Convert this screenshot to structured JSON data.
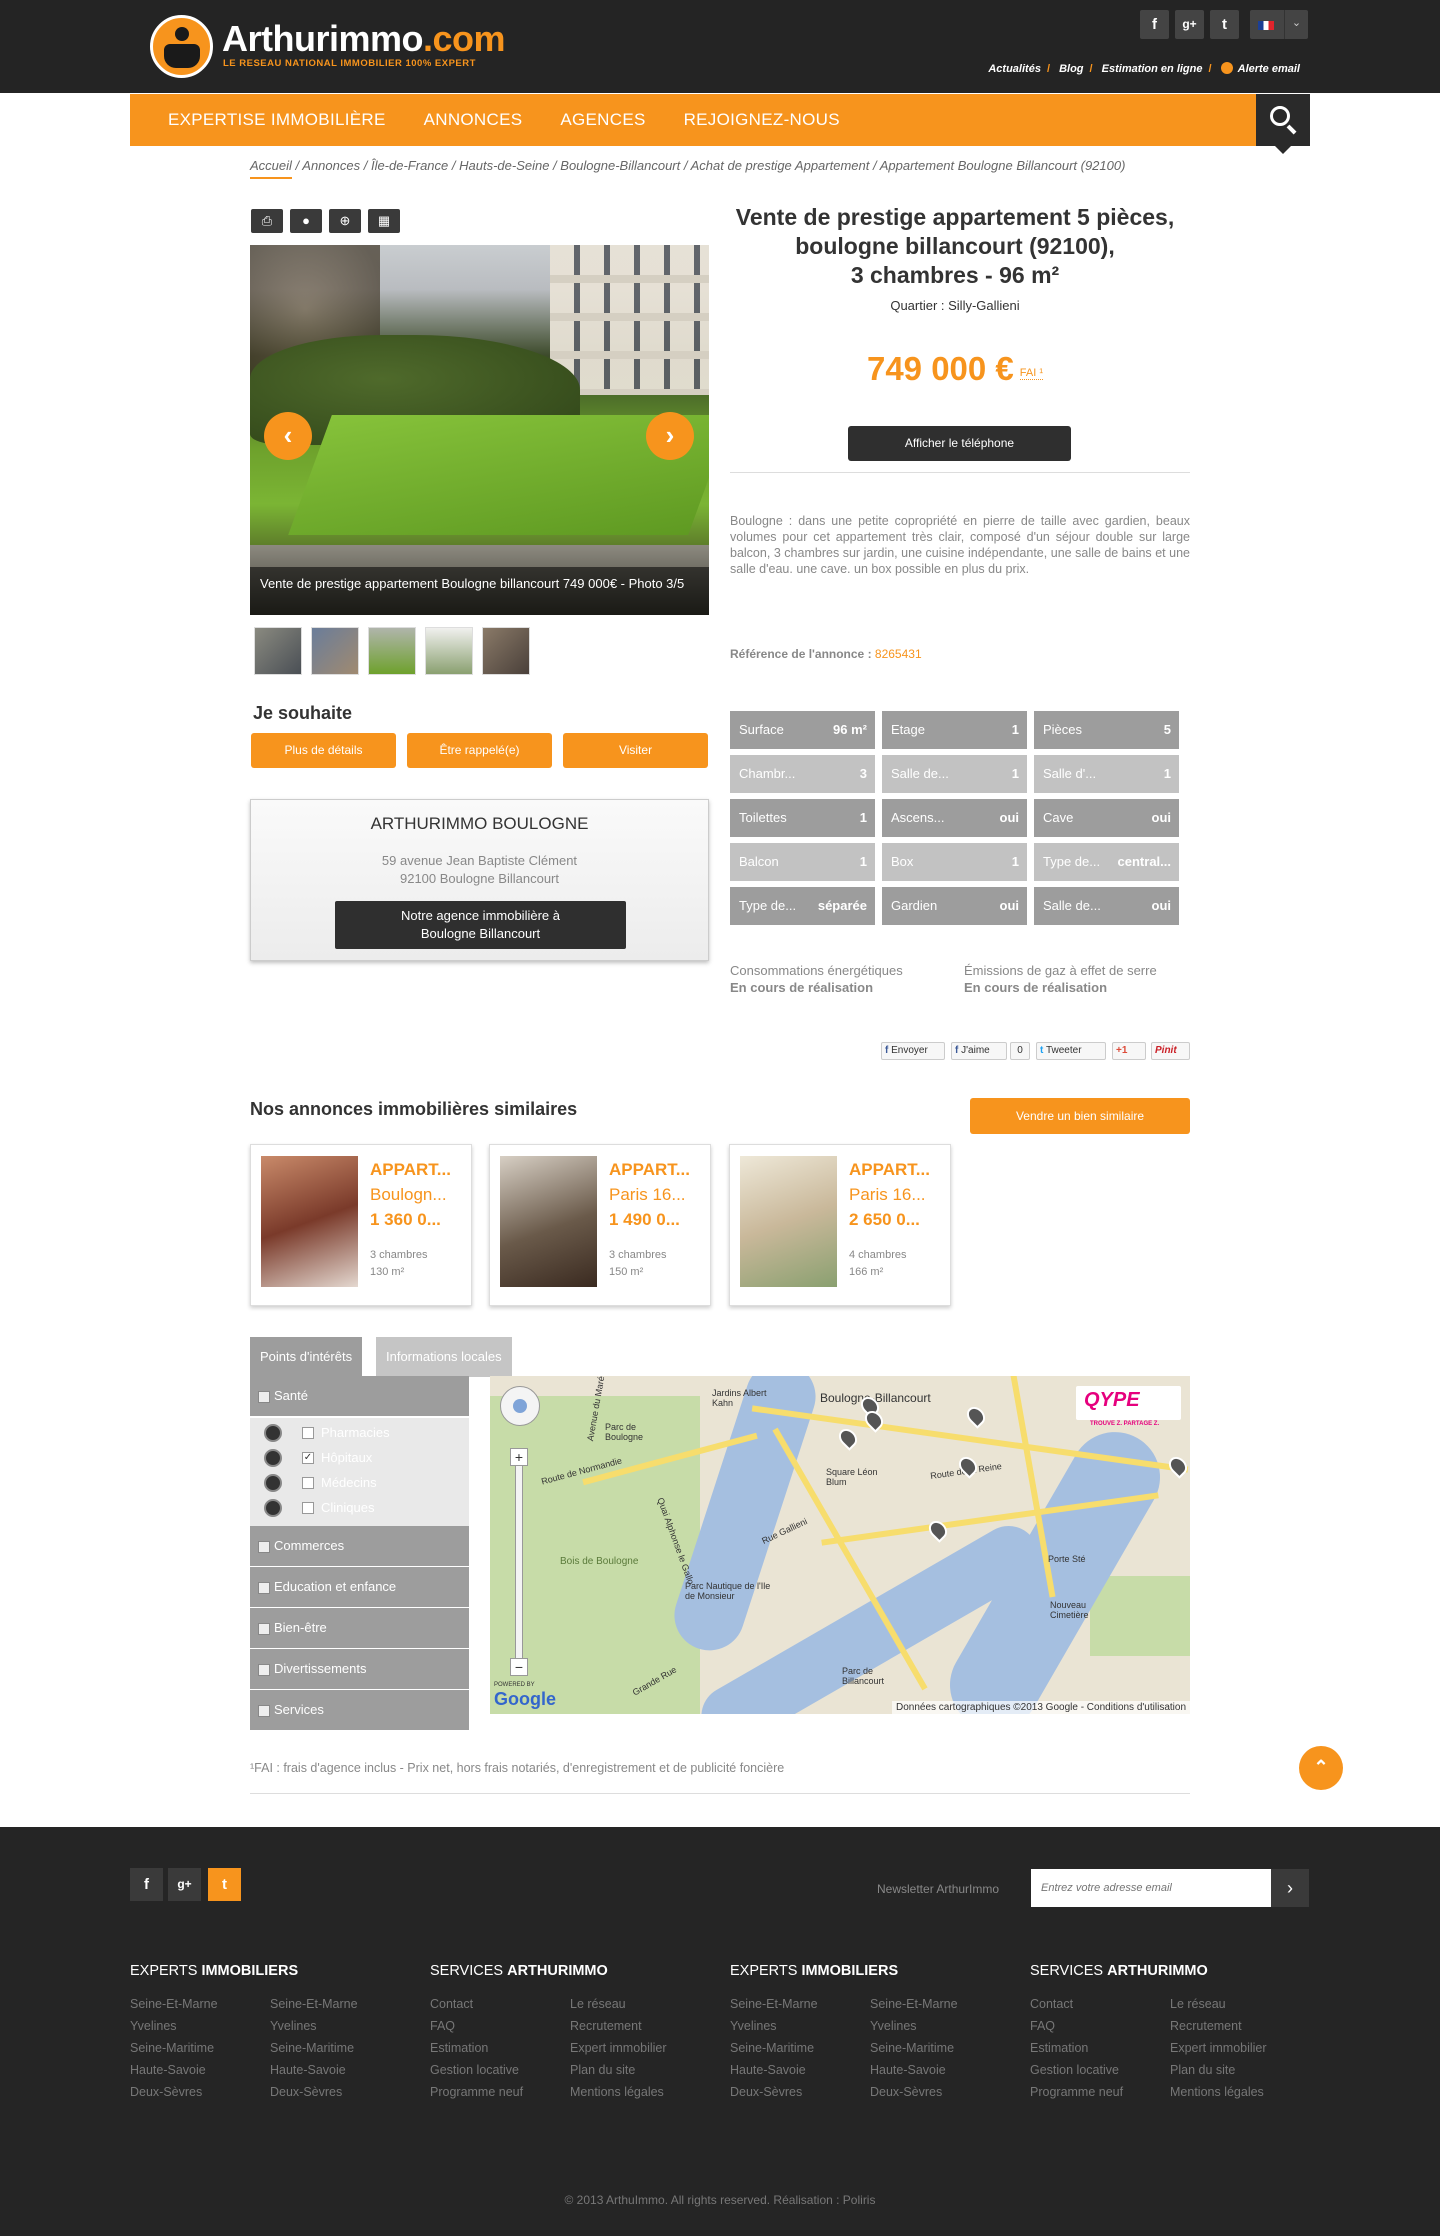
{
  "header": {
    "logo_name": "Arthurimmo",
    "logo_domain": ".com",
    "tagline": "LE RESEAU NATIONAL IMMOBILIER 100% EXPERT",
    "social": [
      "f",
      "g+",
      "t"
    ],
    "language": "FR",
    "toplinks": [
      "Actualités",
      "Blog",
      "Estimation en ligne",
      "Alerte email"
    ]
  },
  "nav": {
    "items": [
      "EXPERTISE IMMOBILIÈRE",
      "ANNONCES",
      "AGENCES",
      "REJOIGNEZ-NOUS"
    ],
    "search_icon": "search-icon"
  },
  "breadcrumb": [
    "Accueil",
    "Annonces",
    "Île-de-France",
    "Hauts-de-Seine",
    "Boulogne-Billancourt",
    "Achat de prestige Appartement",
    "Appartement Boulogne Billancourt (92100)"
  ],
  "tools": [
    "print-icon",
    "user-icon",
    "plus-icon",
    "calculator-icon"
  ],
  "listing": {
    "title_line1": "Vente de prestige appartement 5 pièces,",
    "title_line2": "boulogne billancourt (92100),",
    "title_line3": "3 chambres - 96 m²",
    "quartier": "Quartier : Silly-Gallieni",
    "price": "749 000 €",
    "price_note": "FAI ¹",
    "phone_button": "Afficher le téléphone",
    "description": "Boulogne : dans une petite copropriété en pierre de taille avec gardien, beaux volumes pour cet appartement très clair, composé d'un séjour double sur large balcon, 3 chambres sur jardin, une cuisine indépendante, une salle de bains et une salle d'eau. une cave. un box possible en plus du prix.",
    "ref_label": "Référence de l'annonce :",
    "ref_value": "8265431",
    "photo_caption": "Vente de prestige appartement Boulogne billancourt 749 000€ - Photo 3/5"
  },
  "wish": {
    "title": "Je souhaite",
    "buttons": [
      "Plus de détails",
      "Être rappelé(e)",
      "Visiter"
    ]
  },
  "agency": {
    "name": "ARTHURIMMO BOULOGNE",
    "address1": "59 avenue Jean Baptiste Clément",
    "address2": "92100 Boulogne Billancourt",
    "button_line1": "Notre agence immobilière à",
    "button_line2": "Boulogne Billancourt"
  },
  "features": [
    {
      "label": "Surface",
      "value": "96 m²"
    },
    {
      "label": "Etage",
      "value": "1"
    },
    {
      "label": "Pièces",
      "value": "5"
    },
    {
      "label": "Chambr...",
      "value": "3"
    },
    {
      "label": "Salle de...",
      "value": "1"
    },
    {
      "label": "Salle d'...",
      "value": "1"
    },
    {
      "label": "Toilettes",
      "value": "1"
    },
    {
      "label": "Ascens...",
      "value": "oui"
    },
    {
      "label": "Cave",
      "value": "oui"
    },
    {
      "label": "Balcon",
      "value": "1"
    },
    {
      "label": "Box",
      "value": "1"
    },
    {
      "label": "Type de...",
      "value": "central..."
    },
    {
      "label": "Type de...",
      "value": "séparée"
    },
    {
      "label": "Gardien",
      "value": "oui"
    },
    {
      "label": "Salle de...",
      "value": "oui"
    }
  ],
  "energy": {
    "conso_label": "Consommations énergétiques",
    "conso_value": "En cours de réalisation",
    "ges_label": "Émissions de gaz à effet de serre",
    "ges_value": "En cours de réalisation"
  },
  "share": [
    "Envoyer",
    "J'aime",
    "0",
    "Tweeter",
    "+1",
    "Pinit"
  ],
  "similar": {
    "title": "Nos annonces immobilières similaires",
    "sell_button": "Vendre un bien similaire",
    "cards": [
      {
        "type": "APPART...",
        "city": "Boulogn...",
        "price": "1 360 0...",
        "rooms": "3 chambres",
        "area": "130 m²"
      },
      {
        "type": "APPART...",
        "city": "Paris 16...",
        "price": "1 490 0...",
        "rooms": "3 chambres",
        "area": "150 m²"
      },
      {
        "type": "APPART...",
        "city": "Paris 16...",
        "price": "2 650 0...",
        "rooms": "4 chambres",
        "area": "166 m²"
      }
    ]
  },
  "poi": {
    "tabs": [
      "Points d'intérêts",
      "Informations locales"
    ],
    "categories": [
      "Santé",
      "Commerces",
      "Education et enfance",
      "Bien-être",
      "Divertissements",
      "Services"
    ],
    "sub_items": [
      {
        "label": "Pharmacies",
        "checked": ""
      },
      {
        "label": "Hôpitaux",
        "checked": "✓"
      },
      {
        "label": "Médecins",
        "checked": ""
      },
      {
        "label": "Cliniques",
        "checked": ""
      }
    ]
  },
  "map": {
    "labels": [
      "Boulogne-Billancourt",
      "Jardins Albert Kahn",
      "Parc de Boulogne",
      "Square Léon Blum",
      "Parc Nautique de l'Ile de Monsieur",
      "Parc de Billancourt",
      "Porte Sté",
      "Nouveau Cimetière",
      "Route de la Reine",
      "Rue Gallieni",
      "Avenue du Maréchal Leclerc",
      "Quai Alphonse le Gallo",
      "Grande Rue",
      "Route de Normandie",
      "Bois de Boulogne"
    ],
    "qype": "QYPE",
    "qype_tag": "TROUVE Z. PARTAGE Z.",
    "powered_by": "POWERED BY",
    "google": "Google",
    "copyright": "Données cartographiques ©2013 Google - Conditions d'utilisation",
    "zoom_in": "+",
    "zoom_out": "−"
  },
  "footnote": "¹FAI : frais d'agence inclus - Prix net, hors frais notariés, d'enregistrement et de publicité foncière",
  "footer": {
    "newsletter_label": "Newsletter ArthurImmo",
    "newsletter_placeholder": "Entrez votre adresse email",
    "columns": [
      {
        "t1": "EXPERTS ",
        "t2": "IMMOBILIERS",
        "a": [
          "Seine-Et-Marne",
          "Yvelines",
          "Seine-Maritime",
          "Haute-Savoie",
          "Deux-Sèvres"
        ],
        "b": [
          "Seine-Et-Marne",
          "Yvelines",
          "Seine-Maritime",
          "Haute-Savoie",
          "Deux-Sèvres"
        ]
      },
      {
        "t1": "SERVICES ",
        "t2": "ARTHURIMMO",
        "a": [
          "Contact",
          "FAQ",
          "Estimation",
          "Gestion locative",
          "Programme neuf"
        ],
        "b": [
          "Le réseau",
          "Recrutement",
          "Expert immobilier",
          "Plan du site",
          "Mentions légales"
        ]
      },
      {
        "t1": "EXPERTS ",
        "t2": "IMMOBILIERS",
        "a": [
          "Seine-Et-Marne",
          "Yvelines",
          "Seine-Maritime",
          "Haute-Savoie",
          "Deux-Sèvres"
        ],
        "b": [
          "Seine-Et-Marne",
          "Yvelines",
          "Seine-Maritime",
          "Haute-Savoie",
          "Deux-Sèvres"
        ]
      },
      {
        "t1": "SERVICES ",
        "t2": "ARTHURIMMO",
        "a": [
          "Contact",
          "FAQ",
          "Estimation",
          "Gestion locative",
          "Programme neuf"
        ],
        "b": [
          "Le réseau",
          "Recrutement",
          "Expert immobilier",
          "Plan du site",
          "Mentions légales"
        ]
      }
    ],
    "copyright": "© 2013 ArthuImmo. All rights reserved. Réalisation : Poliris"
  },
  "colors": {
    "accent": "#f7941d",
    "dark": "#242424",
    "feature_light": "#c2c2c2",
    "feature_dark": "#9d9d9d"
  }
}
